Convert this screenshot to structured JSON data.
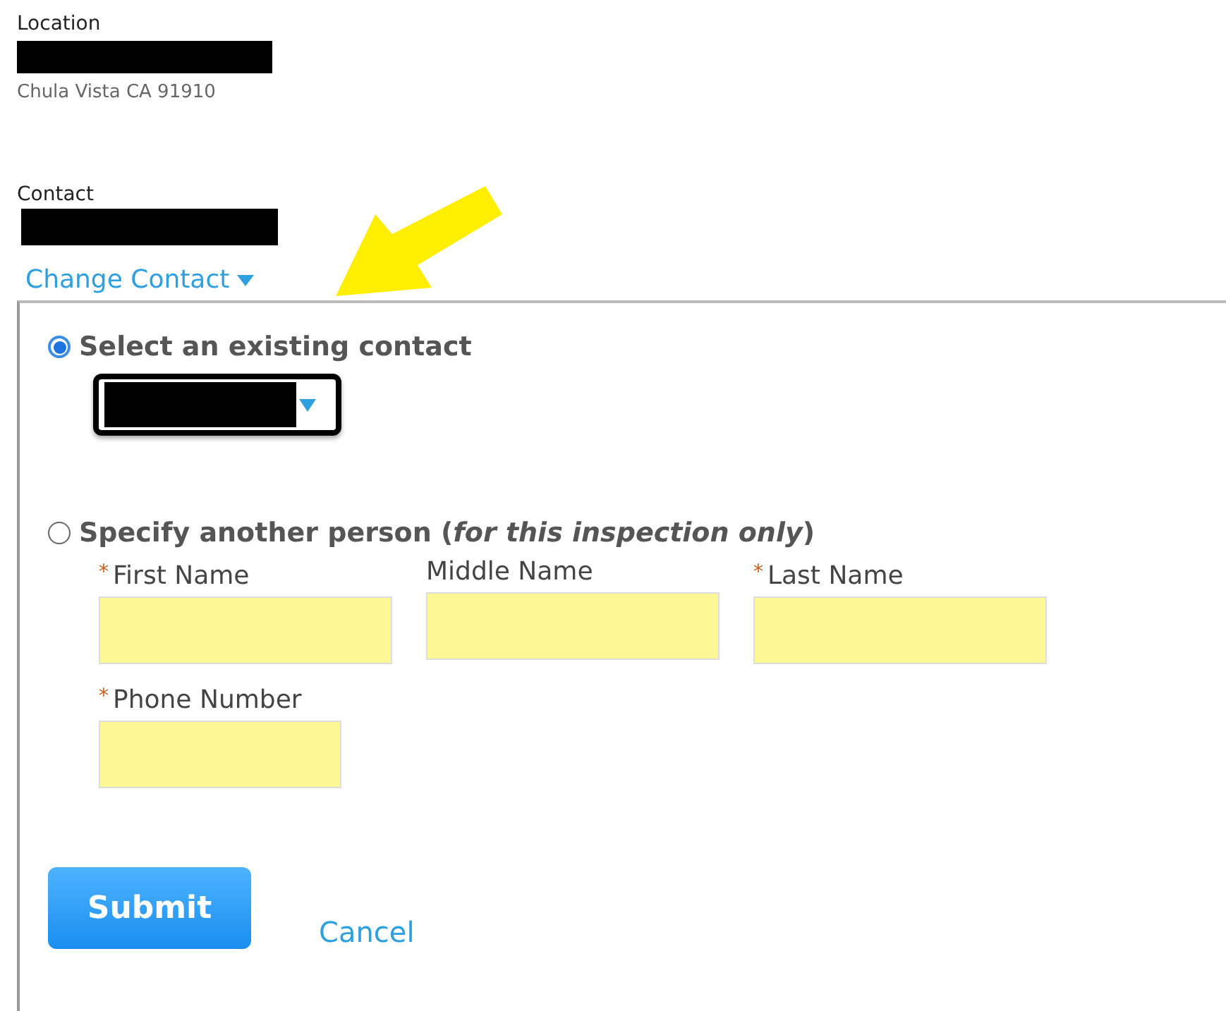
{
  "location": {
    "label": "Location",
    "address": "Chula Vista CA 91910"
  },
  "contact": {
    "label": "Contact"
  },
  "change_contact": {
    "label": "Change Contact",
    "expanded": true
  },
  "options": [
    {
      "kind": "select",
      "label": "Select an existing contact",
      "selected": true
    },
    {
      "kind": "person",
      "label": "Specify another person (*for this inspection only*)",
      "selected": false
    }
  ],
  "fields": [
    {
      "label": "First Name",
      "required_mark": "*",
      "highlighted": true
    },
    {
      "label": "Middle Name",
      "highlighted": true
    },
    {
      "label": "Last Name",
      "required_mark": "*",
      "highlighted": true
    },
    {
      "label": "Phone Number",
      "required_mark": "*",
      "highlighted": true
    }
  ],
  "buttons": {
    "submit": "Submit",
    "cancel": "Cancel"
  }
}
